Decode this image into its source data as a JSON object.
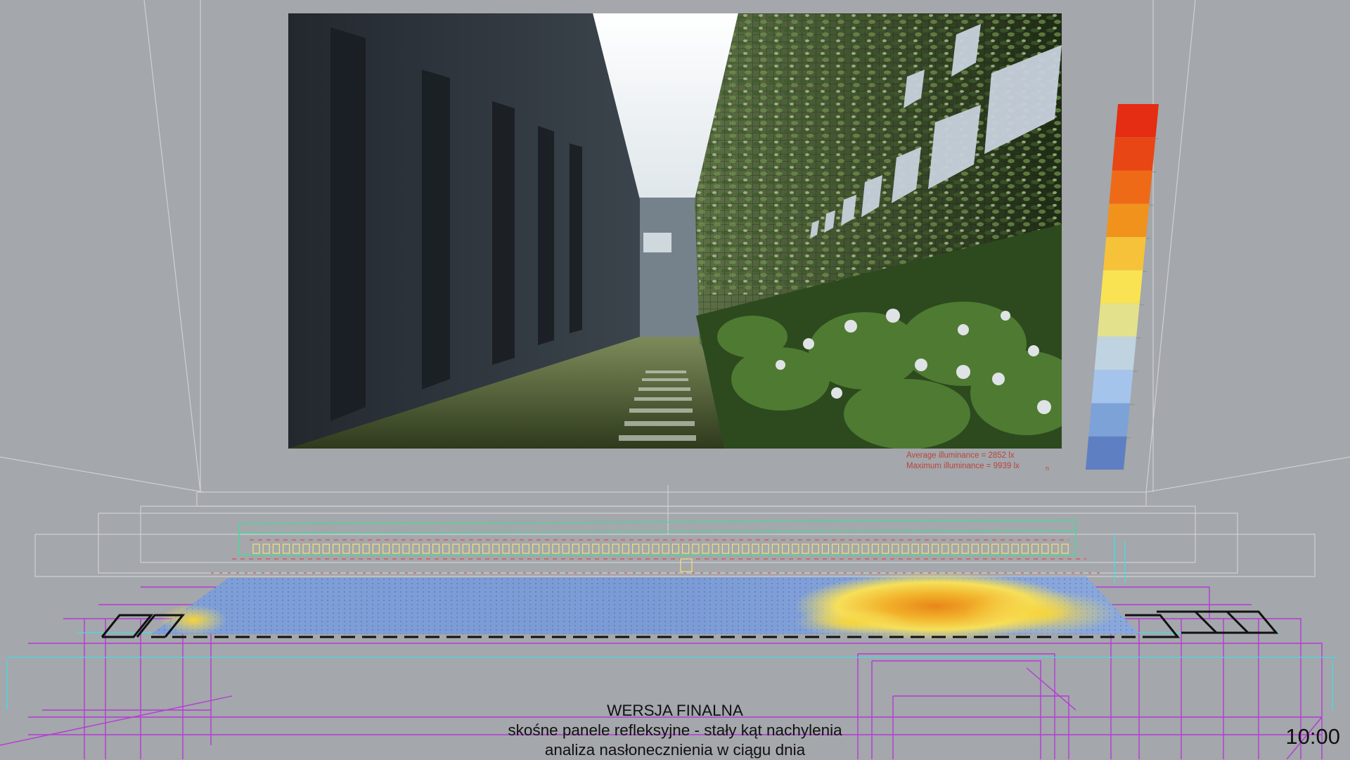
{
  "render_stats": {
    "average": "Average illuminance = 2852 lx",
    "maximum": "Maximum illuminance = 9939 lx",
    "corner_mark": "n"
  },
  "legend": {
    "colors": [
      "#e42d12",
      "#e84614",
      "#ef6a17",
      "#f0921c",
      "#f6c23a",
      "#f9e353",
      "#e4e18d",
      "#bfd3e0",
      "#a5c4ec",
      "#7da2d8",
      "#5e7fc1"
    ]
  },
  "caption": {
    "line1": "WERSJA FINALNA",
    "line2": "skośne panele refleksyjne - stały kąt nachylenia",
    "line3": "analiza nasłonecznienia w ciągu dnia"
  },
  "time": "10:00"
}
